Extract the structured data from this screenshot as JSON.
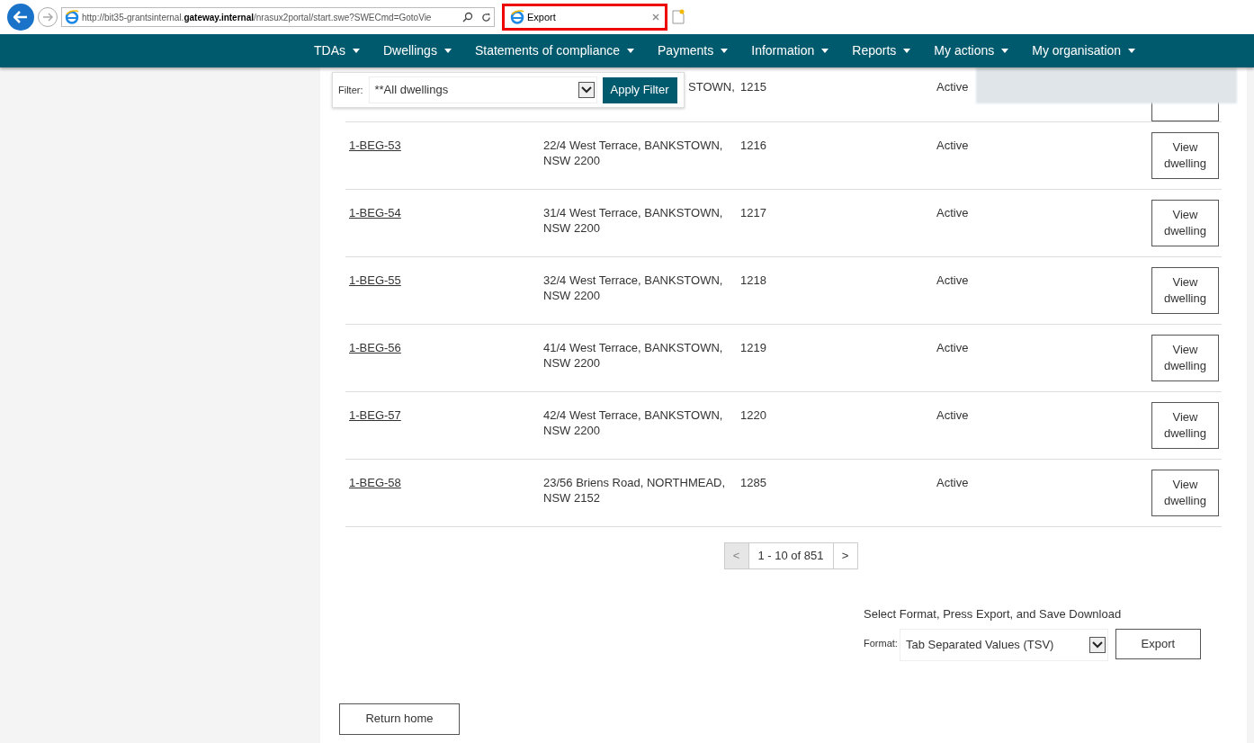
{
  "browser": {
    "url_prefix": "http://bit35-grantsinternal.",
    "url_host": "gateway.internal",
    "url_rest": "/nrasux2portal/start.swe?SWECmd=GotoVie",
    "tab_title": "Export"
  },
  "nav": [
    {
      "label": "TDAs"
    },
    {
      "label": "Dwellings"
    },
    {
      "label": "Statements of compliance"
    },
    {
      "label": "Payments"
    },
    {
      "label": "Information"
    },
    {
      "label": "Reports"
    },
    {
      "label": "My actions"
    },
    {
      "label": "My organisation"
    }
  ],
  "filter": {
    "label": "Filter:",
    "value": "**All dwellings",
    "button": "Apply Filter"
  },
  "partial_row": {
    "address": "STOWN,",
    "number": "1215",
    "status": "Active"
  },
  "rows": [
    {
      "id": "1-BEG-53",
      "address": "22/4 West Terrace, BANKSTOWN, NSW 2200",
      "number": "1216",
      "status": "Active",
      "action": "View dwelling"
    },
    {
      "id": "1-BEG-54",
      "address": "31/4 West Terrace, BANKSTOWN, NSW 2200",
      "number": "1217",
      "status": "Active",
      "action": "View dwelling"
    },
    {
      "id": "1-BEG-55",
      "address": "32/4 West Terrace, BANKSTOWN, NSW 2200",
      "number": "1218",
      "status": "Active",
      "action": "View dwelling"
    },
    {
      "id": "1-BEG-56",
      "address": "41/4 West Terrace, BANKSTOWN, NSW 2200",
      "number": "1219",
      "status": "Active",
      "action": "View dwelling"
    },
    {
      "id": "1-BEG-57",
      "address": "42/4 West Terrace, BANKSTOWN, NSW 2200",
      "number": "1220",
      "status": "Active",
      "action": "View dwelling"
    },
    {
      "id": "1-BEG-58",
      "address": "23/56 Briens Road, NORTHMEAD, NSW 2152",
      "number": "1285",
      "status": "Active",
      "action": "View dwelling"
    }
  ],
  "pagination": {
    "prev": "<",
    "range": "1 - 10 of 851",
    "next": ">",
    "prev_disabled": true
  },
  "export": {
    "instruction": "Select Format, Press Export, and Save Download",
    "format_label": "Format:",
    "format_value": "Tab Separated Values (TSV)",
    "button": "Export"
  },
  "return_button": "Return home"
}
